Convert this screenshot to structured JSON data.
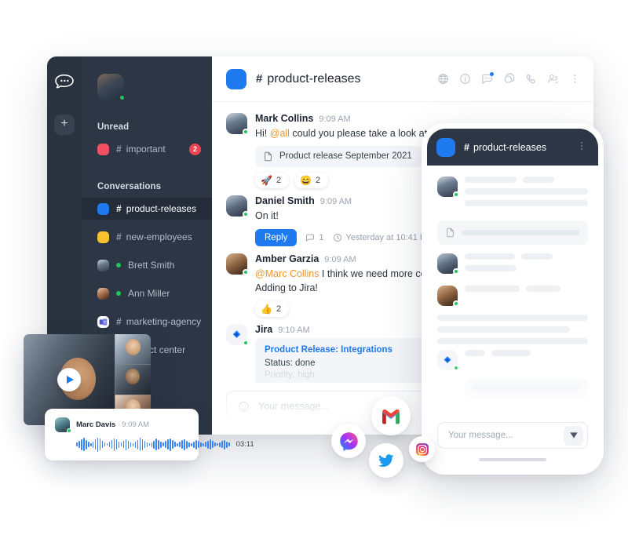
{
  "app": {
    "logo_icon": "rocket-chat-logo",
    "add_button_label": "+"
  },
  "sidebar": {
    "user_status": "online",
    "sections": [
      {
        "title": "Unread"
      },
      {
        "title": "Conversations"
      }
    ],
    "unread_items": [
      {
        "name": "important",
        "prefix": "#",
        "color": "#f0505f",
        "badge": "2",
        "type": "channel"
      }
    ],
    "conversation_items": [
      {
        "name": "product-releases",
        "prefix": "#",
        "color": "#1f7af0",
        "type": "channel",
        "active": true
      },
      {
        "name": "new-employees",
        "prefix": "#",
        "color": "#fbc02d",
        "type": "channel",
        "active": false
      },
      {
        "name": "Brett Smith",
        "prefix": "",
        "type": "user",
        "presence": "online",
        "active": false
      },
      {
        "name": "Ann Miller",
        "prefix": "",
        "type": "user",
        "presence": "online",
        "active": false
      },
      {
        "name": "marketing-agency",
        "prefix": "#",
        "type": "app",
        "app": "teams",
        "active": false
      },
      {
        "name": "contact center",
        "prefix": "#",
        "type": "app",
        "app": "slack",
        "active": false
      }
    ]
  },
  "chat": {
    "channel_name": "product-releases",
    "channel_prefix": "#",
    "channel_color": "#1f7af0",
    "header_icons": [
      "globe-icon",
      "info-icon",
      "discussion-icon",
      "threads-icon",
      "phone-icon",
      "members-icon",
      "kebab-menu-icon"
    ],
    "messages": [
      {
        "author": "Mark Collins",
        "time": "9:09 AM",
        "text_before": "Hi! ",
        "mention": "@all",
        "text_after": " could you please take a look at this",
        "attachment": "Product release September 2021",
        "attachment_icon": "document-icon",
        "reactions": [
          {
            "emoji": "🚀",
            "count": "2"
          },
          {
            "emoji": "😄",
            "count": "2"
          }
        ]
      },
      {
        "author": "Daniel Smith",
        "time": "9:09 AM",
        "text": "On it!",
        "reply_label": "Reply",
        "reply_count": "1",
        "reply_time": "Yesterday at 10:41 PM"
      },
      {
        "author": "Amber Garzia",
        "time": "9:09 AM",
        "mention": "@Marc Collins",
        "text_after": " I think we need more con",
        "line2": "Adding to Jira!",
        "reactions": [
          {
            "emoji": "👍",
            "count": "2"
          }
        ]
      },
      {
        "author": "Jira",
        "time": "9:10 AM",
        "card_title": "Product Release: Integrations",
        "card_line1": "Status: done",
        "card_line2": "Priority: high"
      }
    ],
    "composer": {
      "placeholder": "Your message...",
      "emoji_icon": "smiley-icon"
    }
  },
  "phone": {
    "channel_name": "product-releases",
    "channel_prefix": "#",
    "menu_icon": "kebab-menu-icon",
    "composer": {
      "placeholder": "Your message...",
      "send_icon": "send-icon"
    }
  },
  "video_call": {
    "play_icon": "play-icon",
    "participant_count": "4"
  },
  "voice_message": {
    "author": "Marc Davis",
    "time": "9:09 AM",
    "duration": "03:11",
    "waveform_color": "#3b82f6"
  },
  "floating_icons": [
    {
      "name": "gmail-icon",
      "label": "Gmail"
    },
    {
      "name": "messenger-icon",
      "label": "Messenger"
    },
    {
      "name": "twitter-icon",
      "label": "Twitter"
    },
    {
      "name": "instagram-icon",
      "label": "Instagram"
    }
  ],
  "colors": {
    "sidebar_bg": "#2c3644",
    "rail_bg": "#29323f",
    "accent": "#1f7af0",
    "danger": "#f0505f",
    "online": "#22c55e",
    "mention": "#f0952a"
  }
}
